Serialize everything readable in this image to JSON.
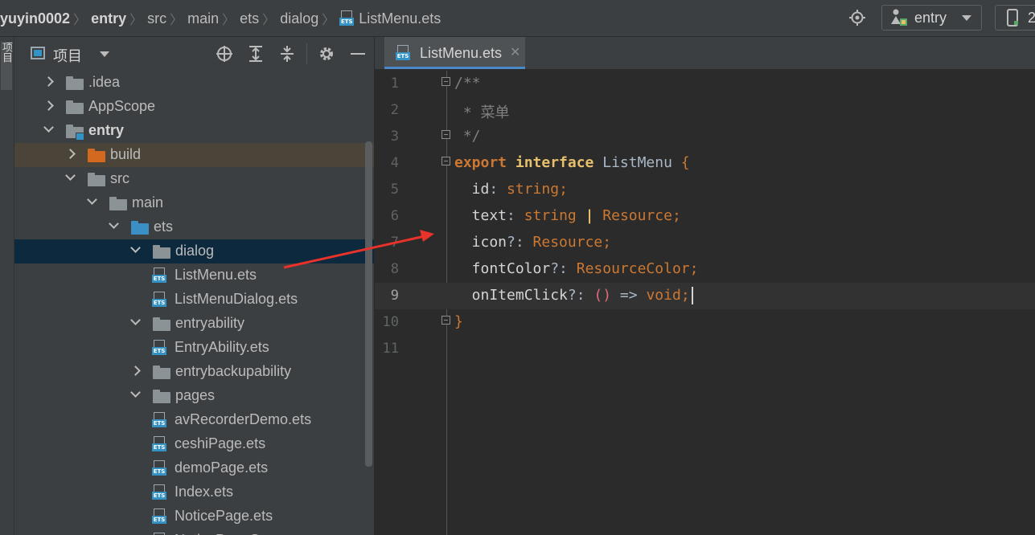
{
  "breadcrumb": [
    "yuyin0002",
    "entry",
    "src",
    "main",
    "ets",
    "dialog",
    "ListMenu.ets"
  ],
  "toolbar": {
    "run_config": "entry",
    "device_label": "2"
  },
  "toolstrip": {
    "label": "项目"
  },
  "project_panel": {
    "title": "项目",
    "tree": [
      {
        "label": ".idea",
        "indent": 0,
        "expanded": false,
        "kind": "folder"
      },
      {
        "label": "AppScope",
        "indent": 0,
        "expanded": false,
        "kind": "folder"
      },
      {
        "label": "entry",
        "indent": 0,
        "expanded": true,
        "kind": "module"
      },
      {
        "label": "build",
        "indent": 1,
        "expanded": false,
        "kind": "folder-orange"
      },
      {
        "label": "src",
        "indent": 1,
        "expanded": true,
        "kind": "folder"
      },
      {
        "label": "main",
        "indent": 2,
        "expanded": true,
        "kind": "folder"
      },
      {
        "label": "ets",
        "indent": 3,
        "expanded": true,
        "kind": "folder-blue"
      },
      {
        "label": "dialog",
        "indent": 4,
        "expanded": true,
        "kind": "folder"
      },
      {
        "label": "ListMenu.ets",
        "indent": 5,
        "kind": "file"
      },
      {
        "label": "ListMenuDialog.ets",
        "indent": 5,
        "kind": "file"
      },
      {
        "label": "entryability",
        "indent": 4,
        "expanded": true,
        "kind": "folder"
      },
      {
        "label": "EntryAbility.ets",
        "indent": 5,
        "kind": "file"
      },
      {
        "label": "entrybackupability",
        "indent": 4,
        "expanded": false,
        "kind": "folder"
      },
      {
        "label": "pages",
        "indent": 4,
        "expanded": true,
        "kind": "folder"
      },
      {
        "label": "avRecorderDemo.ets",
        "indent": 5,
        "kind": "file"
      },
      {
        "label": "ceshiPage.ets",
        "indent": 5,
        "kind": "file"
      },
      {
        "label": "demoPage.ets",
        "indent": 5,
        "kind": "file"
      },
      {
        "label": "Index.ets",
        "indent": 5,
        "kind": "file"
      },
      {
        "label": "NoticePage.ets",
        "indent": 5,
        "kind": "file"
      },
      {
        "label": "NoticePageC...",
        "indent": 5,
        "kind": "file"
      }
    ]
  },
  "editor": {
    "tab_label": "ListMenu.ets",
    "ets_badge": "ETS",
    "current_line": 9,
    "lines": [
      {
        "n": "1",
        "fold": true,
        "segs": [
          {
            "t": "/**",
            "c": "c-comment"
          }
        ]
      },
      {
        "n": "2",
        "fold": false,
        "segs": [
          {
            "t": " * 菜单",
            "c": "c-comment"
          }
        ]
      },
      {
        "n": "3",
        "fold": true,
        "segs": [
          {
            "t": " */",
            "c": "c-comment"
          }
        ]
      },
      {
        "n": "4",
        "fold": true,
        "segs": [
          {
            "t": "export ",
            "c": "c-kw"
          },
          {
            "t": "interface ",
            "c": "c-kw2"
          },
          {
            "t": "ListMenu ",
            "c": "c-iface"
          },
          {
            "t": "{",
            "c": "c-brace"
          }
        ]
      },
      {
        "n": "5",
        "fold": false,
        "segs": [
          {
            "t": "  id",
            "c": "c-prop"
          },
          {
            "t": ": ",
            "c": "c-id"
          },
          {
            "t": "string",
            "c": "c-type"
          },
          {
            "t": ";",
            "c": "c-punc"
          }
        ]
      },
      {
        "n": "6",
        "fold": false,
        "segs": [
          {
            "t": "  text",
            "c": "c-prop"
          },
          {
            "t": ": ",
            "c": "c-id"
          },
          {
            "t": "string",
            "c": "c-type"
          },
          {
            "t": " | ",
            "c": "c-kw2"
          },
          {
            "t": "Resource",
            "c": "c-type"
          },
          {
            "t": ";",
            "c": "c-punc"
          }
        ]
      },
      {
        "n": "7",
        "fold": false,
        "segs": [
          {
            "t": "  icon",
            "c": "c-prop"
          },
          {
            "t": "?: ",
            "c": "c-id"
          },
          {
            "t": "Resource",
            "c": "c-type"
          },
          {
            "t": ";",
            "c": "c-punc"
          }
        ]
      },
      {
        "n": "8",
        "fold": false,
        "segs": [
          {
            "t": "  fontColor",
            "c": "c-prop"
          },
          {
            "t": "?: ",
            "c": "c-id"
          },
          {
            "t": "ResourceColor",
            "c": "c-type"
          },
          {
            "t": ";",
            "c": "c-punc"
          }
        ]
      },
      {
        "n": "9",
        "fold": false,
        "segs": [
          {
            "t": "  onItemClick",
            "c": "c-prop"
          },
          {
            "t": "?: ",
            "c": "c-id"
          },
          {
            "t": "()",
            "c": "c-paren"
          },
          {
            "t": " => ",
            "c": "c-id"
          },
          {
            "t": "void",
            "c": "c-type"
          },
          {
            "t": ";",
            "c": "c-punc"
          }
        ],
        "caret": true
      },
      {
        "n": "10",
        "fold": true,
        "segs": [
          {
            "t": "}",
            "c": "c-brace"
          }
        ]
      },
      {
        "n": "11",
        "fold": false,
        "segs": []
      }
    ]
  },
  "colors": {
    "selection_dialog": "#0d293e",
    "selection_build": "#4a4538",
    "arrow": "#e8322a",
    "accent": "#4a88c7"
  }
}
